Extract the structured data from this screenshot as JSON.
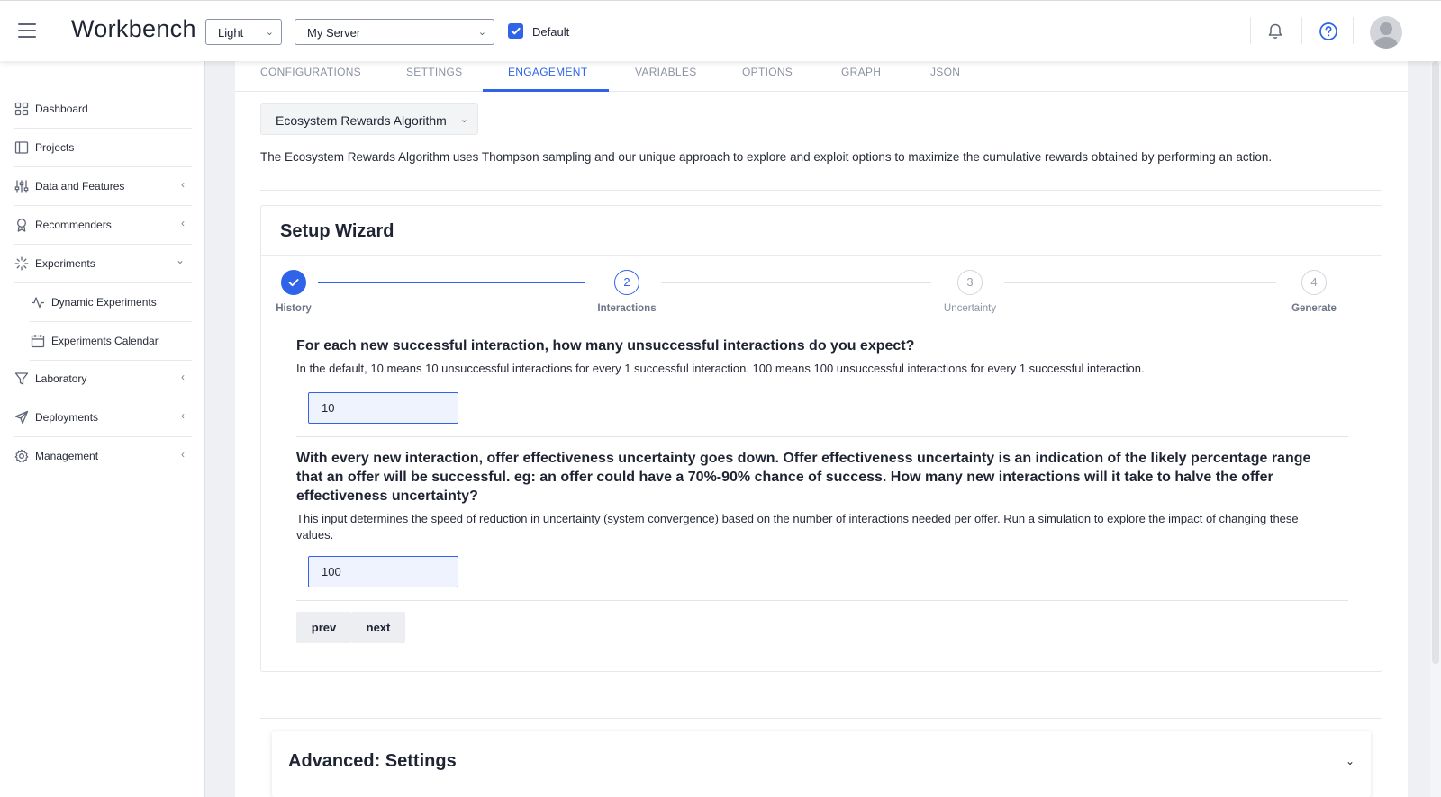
{
  "app": {
    "title": "Workbench"
  },
  "header": {
    "theme_select": "Light",
    "server_select": "My Server",
    "default_checkbox_label": "Default",
    "default_checked": true
  },
  "sidebar": {
    "items": [
      {
        "label": "Dashboard",
        "icon": "grid-icon"
      },
      {
        "label": "Projects",
        "icon": "book-icon"
      },
      {
        "label": "Data and Features",
        "icon": "sliders-icon",
        "expandable": true
      },
      {
        "label": "Recommenders",
        "icon": "award-icon",
        "expandable": true
      },
      {
        "label": "Experiments",
        "icon": "loader-icon",
        "expanded": true
      },
      {
        "label": "Dynamic Experiments",
        "icon": "activity-icon",
        "sub": true
      },
      {
        "label": "Experiments Calendar",
        "icon": "calendar-icon",
        "sub": true
      },
      {
        "label": "Laboratory",
        "icon": "filter-icon",
        "expandable": true
      },
      {
        "label": "Deployments",
        "icon": "send-icon",
        "expandable": true
      },
      {
        "label": "Management",
        "icon": "gear-icon",
        "expandable": true
      }
    ]
  },
  "tabs": [
    {
      "label": "CONFIGURATIONS"
    },
    {
      "label": "SETTINGS"
    },
    {
      "label": "ENGAGEMENT",
      "active": true
    },
    {
      "label": "VARIABLES"
    },
    {
      "label": "OPTIONS"
    },
    {
      "label": "GRAPH"
    },
    {
      "label": "JSON"
    }
  ],
  "algorithm": {
    "selected": "Ecosystem Rewards Algorithm",
    "description": "The Ecosystem Rewards Algorithm uses Thompson sampling and our unique approach to explore and exploit options to maximize the cumulative rewards obtained by performing an action."
  },
  "wizard": {
    "title": "Setup Wizard",
    "steps": [
      {
        "number": "1",
        "label": "History",
        "state": "done"
      },
      {
        "number": "2",
        "label": "Interactions",
        "state": "current"
      },
      {
        "number": "3",
        "label": "Uncertainty",
        "state": "todo"
      },
      {
        "number": "4",
        "label": "Generate",
        "state": "todo"
      }
    ],
    "q1": {
      "title": "For each new successful interaction, how many unsuccessful interactions do you expect?",
      "help": "In the default, 10 means 10 unsuccessful interactions for every 1 successful interaction. 100 means 100 unsuccessful interactions for every 1 successful interaction.",
      "value": "10"
    },
    "q2": {
      "title": "With every new interaction, offer effectiveness uncertainty goes down. Offer effectiveness uncertainty is an indication of the likely percentage range that an offer will be successful. eg: an offer could have a 70%-90% chance of success. How many new interactions will it take to halve the offer effectiveness uncertainty?",
      "help": "This input determines the speed of reduction in uncertainty (system convergence) based on the number of interactions needed per offer. Run a simulation to explore the impact of changing these values.",
      "value": "100"
    },
    "prev_label": "prev",
    "next_label": "next"
  },
  "advanced": {
    "title": "Advanced: Settings"
  },
  "colors": {
    "accent": "#2f64e8",
    "text": "#1f2433",
    "muted": "#8b92a3"
  }
}
